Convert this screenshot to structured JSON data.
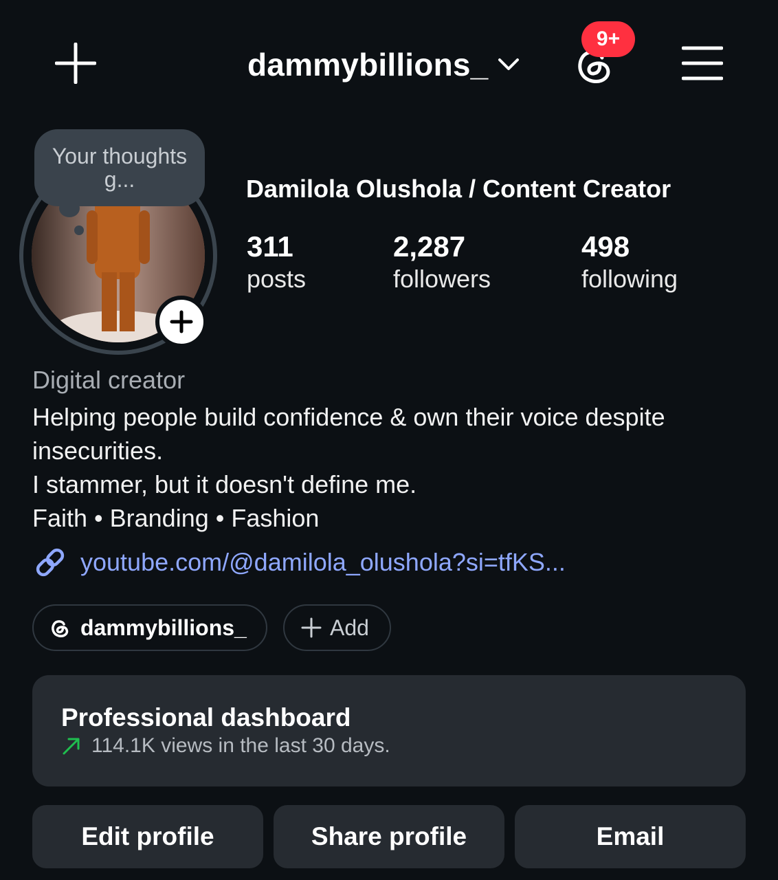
{
  "header": {
    "username": "dammybillions_",
    "notification_badge": "9+",
    "icons": [
      "plus-icon",
      "chevron-down-icon",
      "threads-icon",
      "menu-icon"
    ],
    "badge_color": "#ff3040"
  },
  "profile": {
    "note": "Your thoughts g...",
    "full_name": "Damilola Olushola / Content Creator",
    "stats": [
      {
        "value": "311",
        "label": "posts"
      },
      {
        "value": "2,287",
        "label": "followers"
      },
      {
        "value": "498",
        "label": "following"
      }
    ],
    "category": "Digital creator",
    "bio_lines": [
      "Helping people build confidence & own their voice despite",
      "insecurities.",
      "I stammer, but it doesn't define me.",
      "Faith • Branding • Fashion"
    ],
    "link": "youtube.com/@damilola_olushola?si=tfKS...",
    "link_color": "#8fa8ff"
  },
  "chips": {
    "threads_handle": "dammybillions_",
    "add_label": "Add"
  },
  "dashboard": {
    "title": "Professional dashboard",
    "subtitle": "114.1K views in the last 30 days.",
    "trend_color": "#1fbf4f"
  },
  "actions": {
    "edit": "Edit profile",
    "share": "Share profile",
    "email": "Email"
  }
}
